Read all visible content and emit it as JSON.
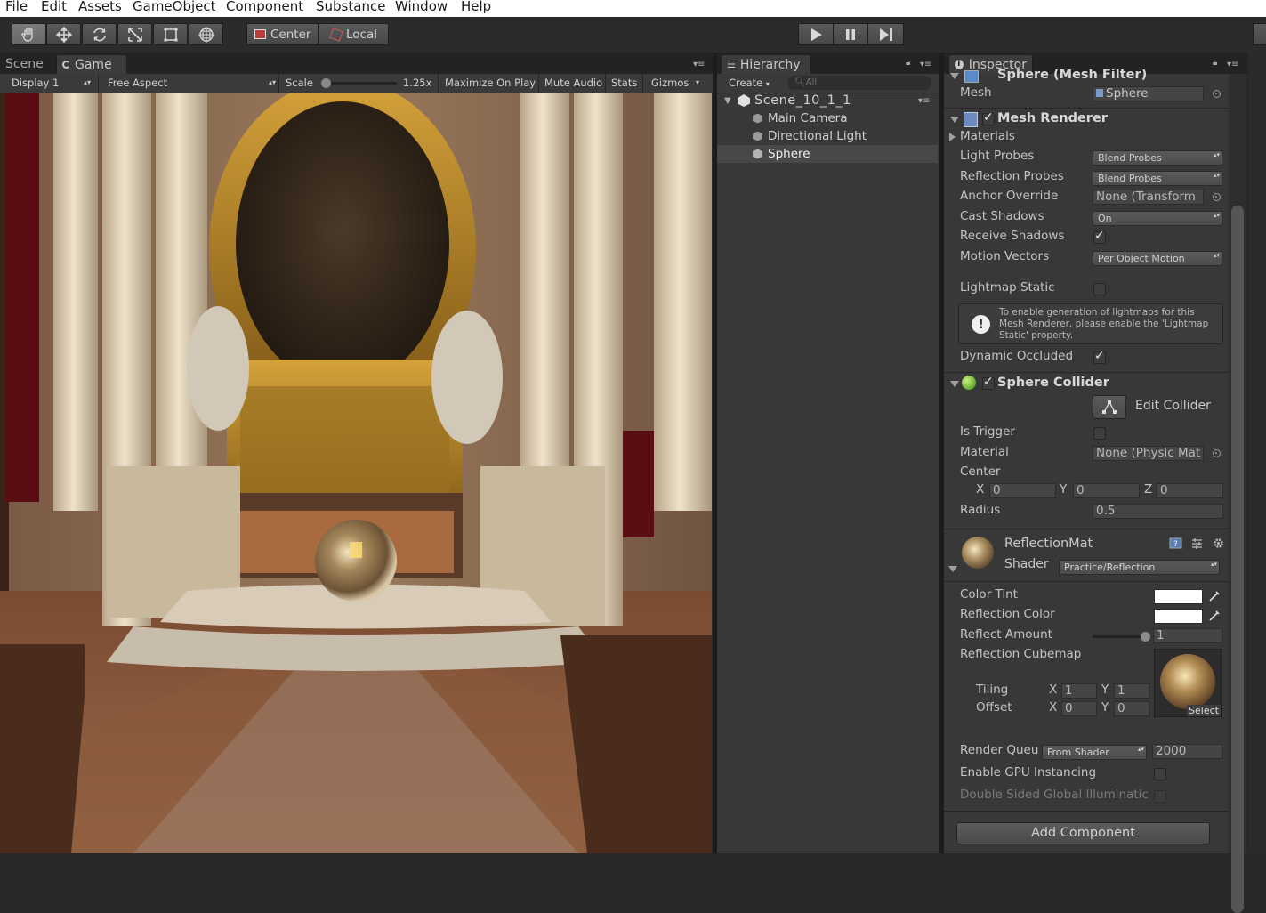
{
  "menu": [
    "File",
    "Edit",
    "Assets",
    "GameObject",
    "Component",
    "Substance",
    "Window",
    "Help"
  ],
  "toolbar": {
    "tools": [
      "hand-icon",
      "move-icon",
      "rotate-icon",
      "scale-icon",
      "rect-icon",
      "transform-icon"
    ],
    "pivot": "Center",
    "space": "Local",
    "play_icons": [
      "play-icon",
      "pause-icon",
      "step-icon"
    ]
  },
  "game": {
    "tabs": {
      "scene": "Scene",
      "game": "Game"
    },
    "display": "Display 1",
    "aspect": "Free Aspect",
    "scale_label": "Scale",
    "scale_value": "1.25x",
    "scale_fraction": 0.0,
    "maximize": "Maximize On Play",
    "mute": "Mute Audio",
    "stats": "Stats",
    "gizmos": "Gizmos"
  },
  "hierarchy": {
    "tab": "Hierarchy",
    "create": "Create",
    "search_placeholder": "All",
    "scene": "Scene_10_1_1",
    "items": [
      "Main Camera",
      "Directional Light",
      "Sphere"
    ],
    "selected": "Sphere"
  },
  "inspector": {
    "tab": "Inspector",
    "mesh_filter": {
      "title": "Sphere (Mesh Filter)",
      "mesh_label": "Mesh",
      "mesh_value": "Sphere"
    },
    "mesh_renderer": {
      "title": "Mesh Renderer",
      "enabled": true,
      "materials": "Materials",
      "light_probes_label": "Light Probes",
      "light_probes": "Blend Probes",
      "reflection_probes_label": "Reflection Probes",
      "reflection_probes": "Blend Probes",
      "anchor_label": "Anchor Override",
      "anchor": "None (Transform",
      "cast_label": "Cast Shadows",
      "cast": "On",
      "receive_label": "Receive Shadows",
      "receive": true,
      "motion_label": "Motion Vectors",
      "motion": "Per Object Motion",
      "lightmap_label": "Lightmap Static",
      "lightmap": false,
      "info": "To enable generation of lightmaps for this Mesh Renderer, please enable the 'Lightmap Static' property.",
      "occluded_label": "Dynamic Occluded",
      "occluded": true
    },
    "sphere_collider": {
      "title": "Sphere Collider",
      "enabled": true,
      "edit_label": "Edit Collider",
      "trigger_label": "Is Trigger",
      "trigger": false,
      "material_label": "Material",
      "material": "None (Physic Mat",
      "center_label": "Center",
      "cx_label": "X",
      "cx": "0",
      "cy_label": "Y",
      "cy": "0",
      "cz_label": "Z",
      "cz": "0",
      "radius_label": "Radius",
      "radius": "0.5"
    },
    "material": {
      "name": "ReflectionMat",
      "shader_label": "Shader",
      "shader": "Practice/Reflection",
      "tint_label": "Color Tint",
      "tint_color": "#ffffff",
      "refl_color_label": "Reflection Color",
      "refl_color": "#ffffff",
      "amount_label": "Reflect Amount",
      "amount": "1",
      "amount_fraction": 1.0,
      "cubemap_label": "Reflection Cubemap",
      "tiling_label": "Tiling",
      "offset_label": "Offset",
      "tx_label": "X",
      "tx": "1",
      "ty_label": "Y",
      "ty": "1",
      "ox_label": "X",
      "ox": "0",
      "oy_label": "Y",
      "oy": "0",
      "select": "Select",
      "queue_label": "Render Queu",
      "queue_mode": "From Shader",
      "queue": "2000",
      "gpu_label": "Enable GPU Instancing",
      "gpu": false,
      "dsgi_label": "Double Sided Global Illuminatic",
      "dsgi": false
    },
    "add_component": "Add Component"
  }
}
